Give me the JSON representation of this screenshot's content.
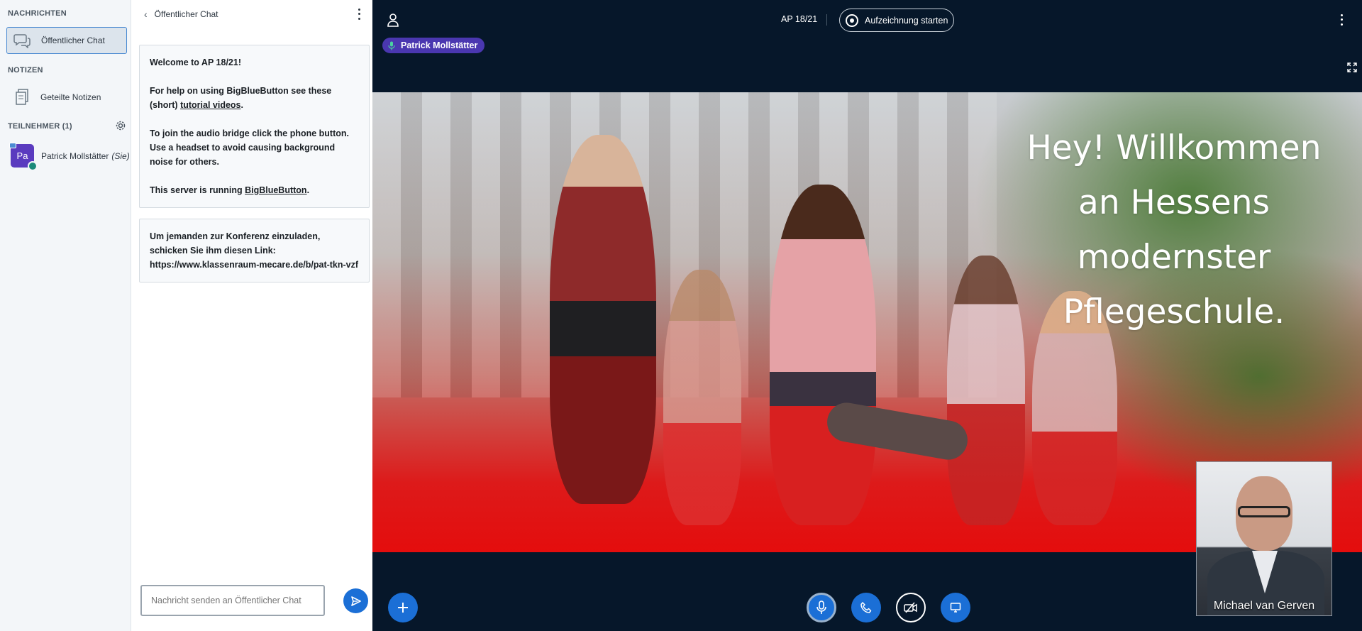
{
  "sidebar": {
    "messages_title": "NACHRICHTEN",
    "public_chat_label": "Öffentlicher Chat",
    "notes_title": "NOTIZEN",
    "shared_notes_label": "Geteilte Notizen",
    "participants_title": "TEILNEHMER (1)",
    "participant": {
      "initials": "Pa",
      "name": "Patrick Mollstätter",
      "you_label": "(Sie)"
    }
  },
  "chat": {
    "header_title": "Öffentlicher Chat",
    "welcome": {
      "line1": "Welcome to AP 18/21!",
      "help_prefix": "For help on using BigBlueButton see these (short) ",
      "help_link": "tutorial videos",
      "help_suffix": ".",
      "audio": "To join the audio bridge click the phone button. Use a headset to avoid causing background noise for others.",
      "server_prefix": "This server is running ",
      "server_link": "BigBlueButton",
      "server_suffix": "."
    },
    "invite": {
      "text": "Um jemanden zur Konferenz einzuladen, schicken Sie ihm diesen Link:",
      "link": "https://www.klassenraum-mecare.de/b/pat-tkn-vzf"
    },
    "input_placeholder": "Nachricht senden an Öffentlicher Chat"
  },
  "main": {
    "meeting_title": "AP 18/21",
    "record_label": "Aufzeichnung starten",
    "talker_name": "Patrick Mollstätter",
    "slide_text_lines": [
      "Hey! Willkommen",
      "an Hessens modernster",
      "Pflegeschule."
    ],
    "webcam_name": "Michael van Gerven"
  },
  "colors": {
    "primary": "#1b6fd6",
    "background": "#06172a",
    "talker": "#4a37b0",
    "avatar": "#5a3bbf"
  },
  "icons": [
    "chat-icon",
    "notes-icon",
    "gear-icon",
    "user-icon",
    "record-icon",
    "more-icon",
    "fullscreen-icon",
    "plus-icon",
    "mic-icon",
    "phone-icon",
    "camera-off-icon",
    "screen-share-icon",
    "send-icon",
    "back-icon"
  ]
}
